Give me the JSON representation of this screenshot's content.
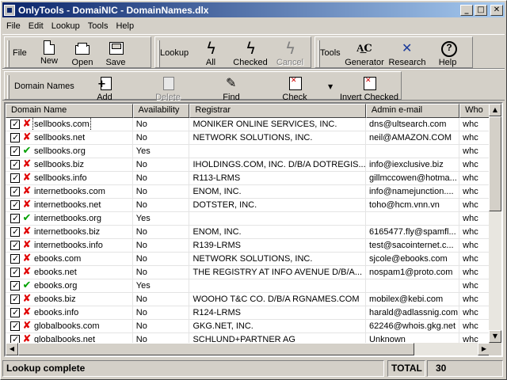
{
  "window": {
    "title": "OnlyTools - DomaiNIC - DomainNames.dlx"
  },
  "titlebar_buttons": {
    "minimize": "_",
    "maximize": "□",
    "close": "✕"
  },
  "menu": [
    "File",
    "Edit",
    "Lookup",
    "Tools",
    "Help"
  ],
  "toolbar": {
    "file_group": "File",
    "new": "New",
    "open": "Open",
    "save": "Save",
    "lookup_group": "Lookup",
    "all": "All",
    "checked": "Checked",
    "cancel": "Cancel",
    "tools_group": "Tools",
    "generator": "Generator",
    "research": "Research",
    "help": "Help"
  },
  "toolbar2": {
    "group": "Domain Names",
    "add": "Add",
    "delete": "Delete",
    "find": "Find",
    "check": "Check",
    "invert_checked": "Invert Checked"
  },
  "grid": {
    "columns": [
      "Domain Name",
      "Availability",
      "Registrar",
      "Admin e-mail",
      "Who"
    ],
    "rows": [
      {
        "domain": "sellbooks.com",
        "available": false,
        "availability": "No",
        "registrar": "MONIKER ONLINE SERVICES, INC.",
        "email": "dns@ultsearch.com",
        "whois": "whc"
      },
      {
        "domain": "sellbooks.net",
        "available": false,
        "availability": "No",
        "registrar": "NETWORK SOLUTIONS, INC.",
        "email": "neil@AMAZON.COM",
        "whois": "whc"
      },
      {
        "domain": "sellbooks.org",
        "available": true,
        "availability": "Yes",
        "registrar": "",
        "email": "",
        "whois": "whc"
      },
      {
        "domain": "sellbooks.biz",
        "available": false,
        "availability": "No",
        "registrar": "IHOLDINGS.COM, INC. D/B/A DOTREGIS...",
        "email": "info@iexclusive.biz",
        "whois": "whc"
      },
      {
        "domain": "sellbooks.info",
        "available": false,
        "availability": "No",
        "registrar": "R113-LRMS",
        "email": "gillmccowen@hotma...",
        "whois": "whc"
      },
      {
        "domain": "internetbooks.com",
        "available": false,
        "availability": "No",
        "registrar": "ENOM, INC.",
        "email": "info@namejunction....",
        "whois": "whc"
      },
      {
        "domain": "internetbooks.net",
        "available": false,
        "availability": "No",
        "registrar": "DOTSTER, INC.",
        "email": "toho@hcm.vnn.vn",
        "whois": "whc"
      },
      {
        "domain": "internetbooks.org",
        "available": true,
        "availability": "Yes",
        "registrar": "",
        "email": "",
        "whois": "whc"
      },
      {
        "domain": "internetbooks.biz",
        "available": false,
        "availability": "No",
        "registrar": "ENOM, INC.",
        "email": "6165477.fly@spamfl...",
        "whois": "whc"
      },
      {
        "domain": "internetbooks.info",
        "available": false,
        "availability": "No",
        "registrar": "R139-LRMS",
        "email": "test@sacointernet.c...",
        "whois": "whc"
      },
      {
        "domain": "ebooks.com",
        "available": false,
        "availability": "No",
        "registrar": "NETWORK SOLUTIONS, INC.",
        "email": "sjcole@ebooks.com",
        "whois": "whc"
      },
      {
        "domain": "ebooks.net",
        "available": false,
        "availability": "No",
        "registrar": "THE REGISTRY AT INFO AVENUE D/B/A...",
        "email": "nospam1@proto.com",
        "whois": "whc"
      },
      {
        "domain": "ebooks.org",
        "available": true,
        "availability": "Yes",
        "registrar": "",
        "email": "",
        "whois": "whc"
      },
      {
        "domain": "ebooks.biz",
        "available": false,
        "availability": "No",
        "registrar": "WOOHO T&C CO. D/B/A RGNAMES.COM",
        "email": "mobilex@kebi.com",
        "whois": "whc"
      },
      {
        "domain": "ebooks.info",
        "available": false,
        "availability": "No",
        "registrar": "R124-LRMS",
        "email": "harald@adlassnig.com",
        "whois": "whc"
      },
      {
        "domain": "globalbooks.com",
        "available": false,
        "availability": "No",
        "registrar": "GKG.NET, INC.",
        "email": "62246@whois.gkg.net",
        "whois": "whc"
      },
      {
        "domain": "globalbooks.net",
        "available": false,
        "availability": "No",
        "registrar": "SCHLUND+PARTNER AG",
        "email": "Unknown",
        "whois": "whc"
      }
    ]
  },
  "scroll_arrows": {
    "up": "▲",
    "down": "▼",
    "left": "◀",
    "right": "▶"
  },
  "status": {
    "message": "Lookup complete",
    "total_label": "TOTAL",
    "total_value": "30"
  }
}
